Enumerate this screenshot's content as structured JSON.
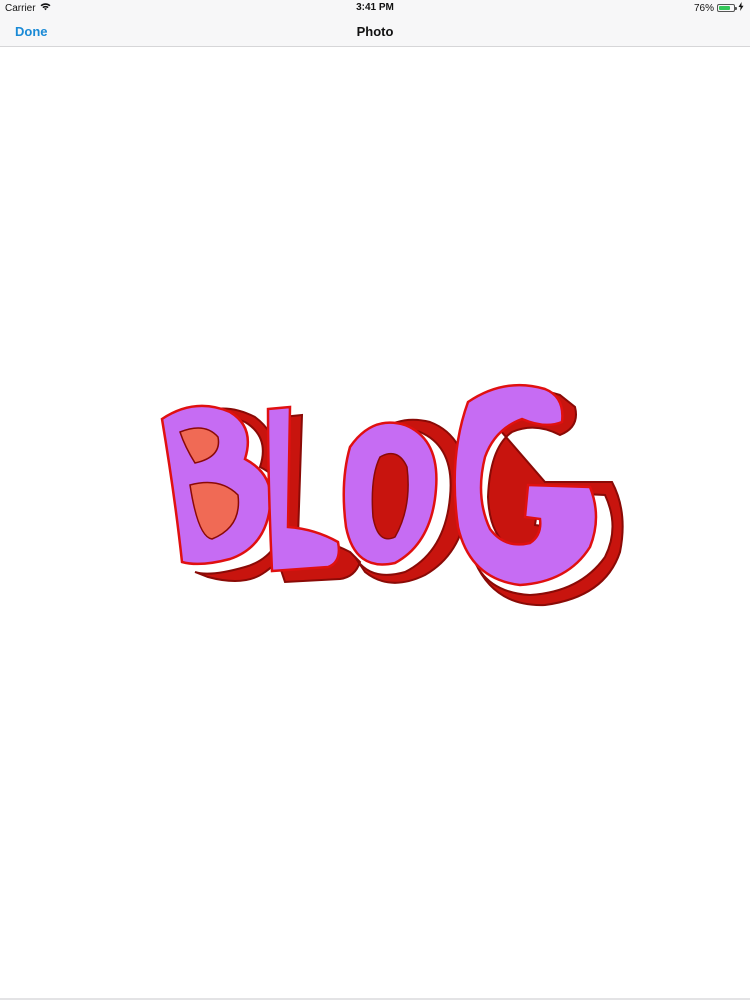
{
  "status_bar": {
    "carrier": "Carrier",
    "time": "3:41 PM",
    "battery_percent_label": "76%",
    "battery_level": 0.76,
    "icons": [
      "wifi-icon",
      "battery-icon",
      "charging-icon"
    ]
  },
  "nav_bar": {
    "done_label": "Done",
    "title": "Photo"
  },
  "photo": {
    "description_word": "BLOG",
    "colors": {
      "face": "#c66cf3",
      "extrusion": "#c8140e",
      "outline": "#e01010",
      "inner_shadow": "#f06a55"
    }
  },
  "colors": {
    "accent": "#1a8ad6",
    "bar_background": "#f7f7f8",
    "battery_green": "#34c759"
  }
}
